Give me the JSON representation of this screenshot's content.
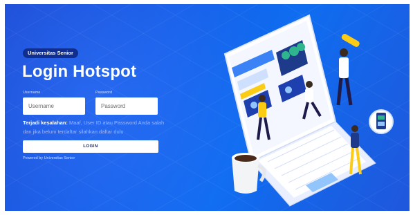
{
  "brand": {
    "badge": "Universitas Senior"
  },
  "login": {
    "title": "Login Hotspot",
    "username_label": "Username",
    "username_placeholder": "Username",
    "password_label": "Password",
    "password_placeholder": "Password",
    "error_heading": "Terjadi kesalahan:",
    "error_message": " Maaf, User ID atau Password Anda salah dan jika belum terdaftar silahkan daftar dulu",
    "button_label": "LOGIN"
  },
  "footer": {
    "powered_by": "Powered by Universitas Senior"
  },
  "colors": {
    "background": "#1660e8",
    "badge": "#0f2e8f",
    "button": "#ffffff"
  },
  "illustration": {
    "icon": "laptop-people-illustration"
  }
}
